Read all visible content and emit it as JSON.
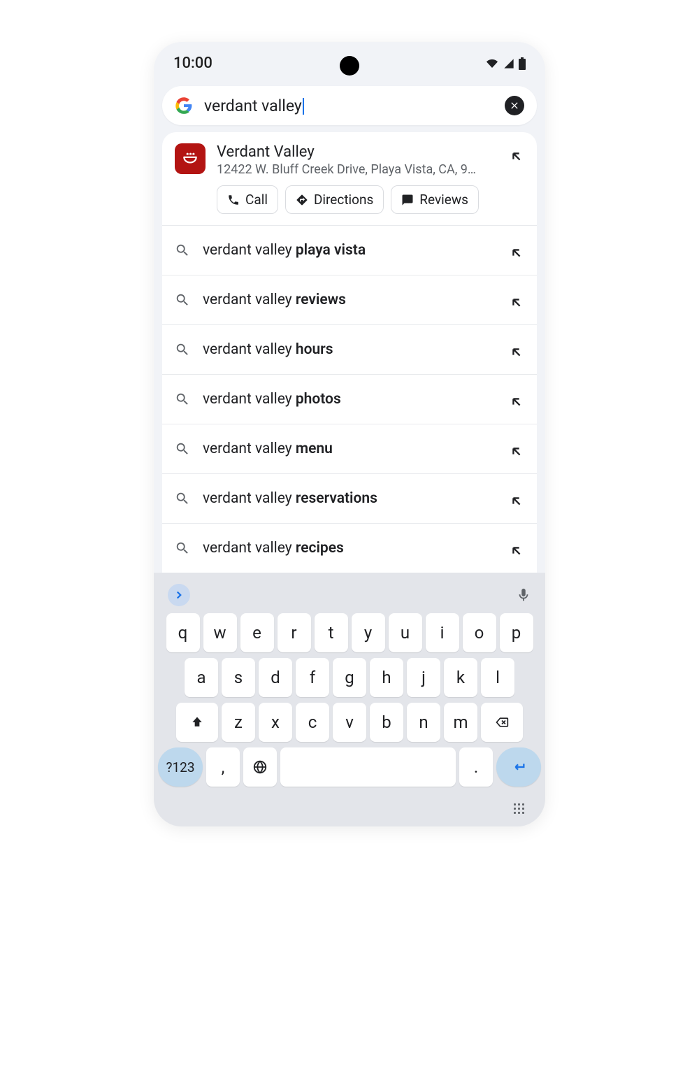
{
  "status": {
    "time": "10:00"
  },
  "search": {
    "query": "verdant valley"
  },
  "place": {
    "name": "Verdant Valley",
    "address": "12422 W. Bluff Creek Drive, Playa Vista, CA, 900...",
    "actions": {
      "call": "Call",
      "directions": "Directions",
      "reviews": "Reviews"
    }
  },
  "suggestions": [
    {
      "prefix": "verdant valley ",
      "suffix": "playa vista"
    },
    {
      "prefix": "verdant valley ",
      "suffix": "reviews"
    },
    {
      "prefix": "verdant valley ",
      "suffix": "hours"
    },
    {
      "prefix": "verdant valley ",
      "suffix": "photos"
    },
    {
      "prefix": "verdant valley ",
      "suffix": "menu"
    },
    {
      "prefix": "verdant valley ",
      "suffix": "reservations"
    },
    {
      "prefix": "verdant valley ",
      "suffix": "recipes"
    }
  ],
  "keyboard": {
    "row1": [
      "q",
      "w",
      "e",
      "r",
      "t",
      "y",
      "u",
      "i",
      "o",
      "p"
    ],
    "row2": [
      "a",
      "s",
      "d",
      "f",
      "g",
      "h",
      "j",
      "k",
      "l"
    ],
    "row3": [
      "z",
      "x",
      "c",
      "v",
      "b",
      "n",
      "m"
    ],
    "num": "?123",
    "comma": ",",
    "period": "."
  }
}
